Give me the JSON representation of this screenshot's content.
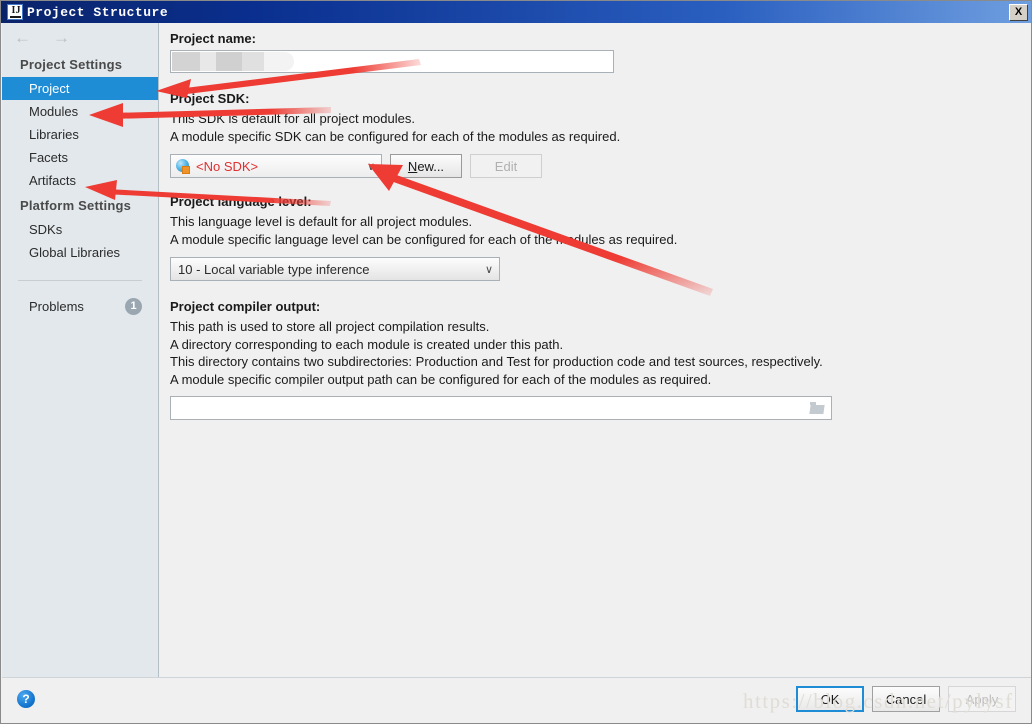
{
  "window": {
    "title": "Project Structure",
    "app_icon": "intellij-idea-icon",
    "close_label": "X"
  },
  "nav": {
    "back_icon": "arrow-left-icon",
    "back_glyph": "←",
    "forward_icon": "arrow-right-icon",
    "forward_glyph": "→"
  },
  "sidebar": {
    "groups": [
      {
        "label": "Project Settings",
        "items": [
          {
            "label": "Project",
            "selected": true
          },
          {
            "label": "Modules",
            "selected": false
          },
          {
            "label": "Libraries",
            "selected": false
          },
          {
            "label": "Facets",
            "selected": false
          },
          {
            "label": "Artifacts",
            "selected": false
          }
        ]
      },
      {
        "label": "Platform Settings",
        "items": [
          {
            "label": "SDKs",
            "selected": false
          },
          {
            "label": "Global Libraries",
            "selected": false
          }
        ]
      }
    ],
    "problems": {
      "label": "Problems",
      "badge_count": "1"
    }
  },
  "main": {
    "project_name": {
      "label": "Project name:",
      "value": "",
      "redacted": true
    },
    "project_sdk": {
      "label": "Project SDK:",
      "desc_line_1": "This SDK is default for all project modules.",
      "desc_line_2": "A module specific SDK can be configured for each of the modules as required.",
      "selected_value": "<No SDK>",
      "selected_value_color": "#e03030",
      "icon": "sdk-sphere-icon",
      "chevron": "∨",
      "new_button": {
        "prefix": "",
        "accel": "N",
        "suffix": "ew..."
      },
      "edit_button": {
        "label": "Edit",
        "disabled": true
      }
    },
    "project_language_level": {
      "label": "Project language level:",
      "desc_line_1": "This language level is default for all project modules.",
      "desc_line_2": "A module specific language level can be configured for each of the modules as required.",
      "selected_value": "10 - Local variable type inference",
      "chevron": "∨"
    },
    "project_compiler_output": {
      "label": "Project compiler output:",
      "desc_line_1": "This path is used to store all project compilation results.",
      "desc_line_2": "A directory corresponding to each module is created under this path.",
      "desc_line_3": "This directory contains two subdirectories: Production and Test for production code and test sources, respectively.",
      "desc_line_4": "A module specific compiler output path can be configured for each of the modules as required.",
      "value": "",
      "placeholder": "",
      "browse_icon": "folder-icon"
    }
  },
  "footer": {
    "help_icon": "help-question-icon",
    "help_glyph": "?",
    "ok_label": "OK",
    "cancel_label": "Cancel",
    "apply_label": "Apply",
    "apply_disabled": true
  },
  "watermark": {
    "text": "https://blog.csdn.net/pylysf"
  },
  "annotations": {
    "arrow_color": "#ee3b33",
    "arrows": [
      {
        "name": "arrow-to-project-item",
        "target": "Project sidebar item"
      },
      {
        "name": "arrow-to-modules-item",
        "target": "Modules sidebar item"
      },
      {
        "name": "arrow-to-artifacts-item",
        "target": "Artifacts sidebar item"
      },
      {
        "name": "arrow-to-sdk-dropdown",
        "target": "Project SDK dropdown"
      }
    ]
  }
}
